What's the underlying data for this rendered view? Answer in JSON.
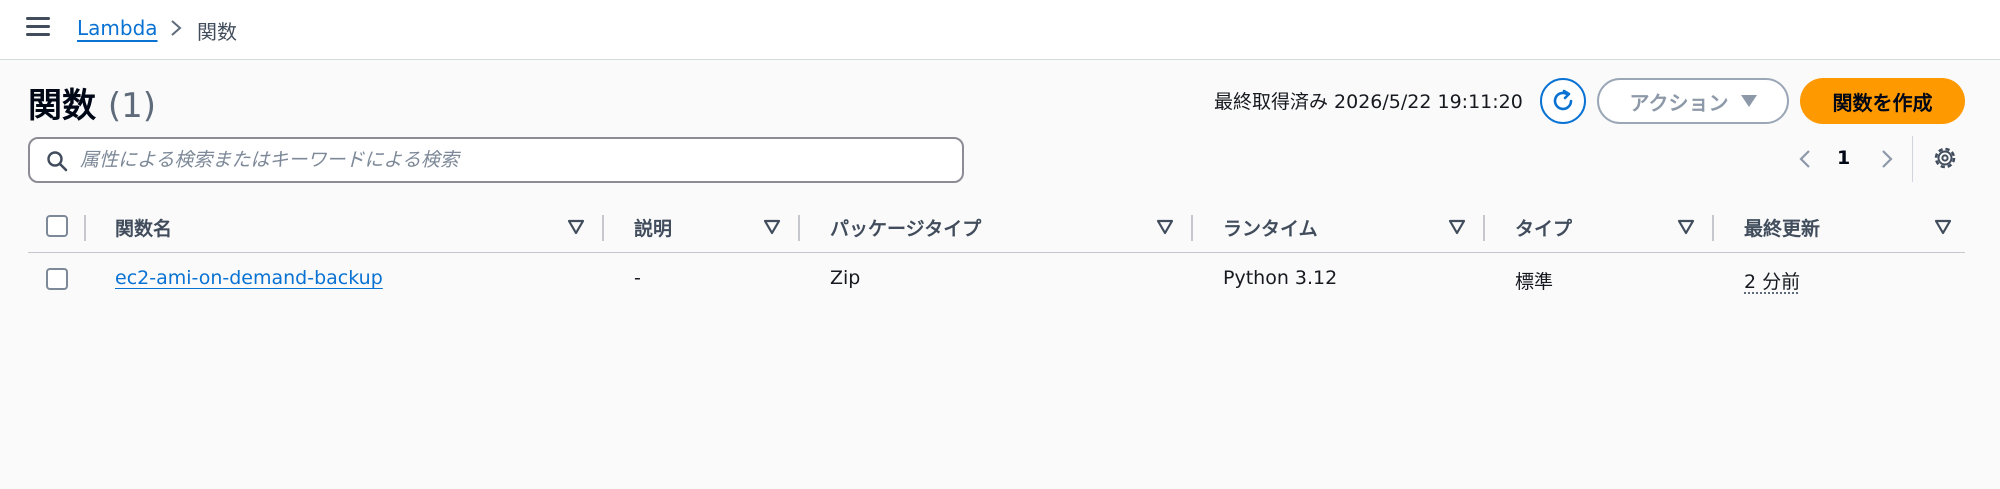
{
  "breadcrumb": {
    "parent": "Lambda",
    "current": "関数"
  },
  "header": {
    "title": "関数",
    "count": "(1)",
    "last_fetched": "最終取得済み 2026/5/22 19:11:20",
    "actions_label": "アクション",
    "create_label": "関数を作成"
  },
  "search": {
    "placeholder": "属性による検索またはキーワードによる検索"
  },
  "pagination": {
    "current_page": "1"
  },
  "table": {
    "columns": [
      "関数名",
      "説明",
      "パッケージタイプ",
      "ランタイム",
      "タイプ",
      "最終更新"
    ],
    "rows": [
      {
        "name": "ec2-ami-on-demand-backup",
        "description": "-",
        "package_type": "Zip",
        "runtime": "Python 3.12",
        "type": "標準",
        "last_modified": "2 分前"
      }
    ]
  },
  "colors": {
    "primary": "#ff9900",
    "link": "#0972d3",
    "border": "#c6c6cd"
  }
}
